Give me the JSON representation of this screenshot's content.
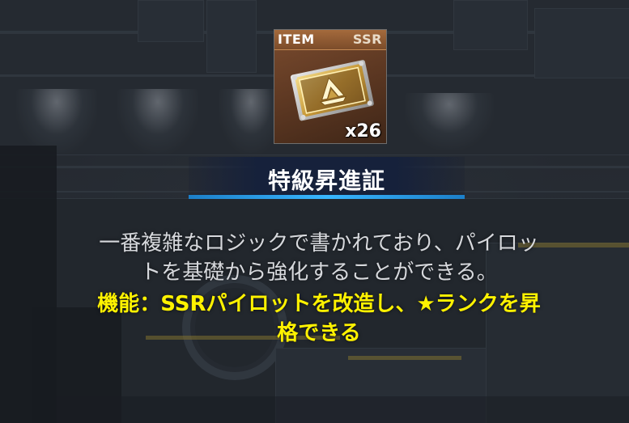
{
  "item": {
    "type_label": "ITEM",
    "rarity": "SSR",
    "count": "x26",
    "icon": "promotion-certificate-icon",
    "name": "特級昇進証"
  },
  "description": {
    "line1": "一番複雑なロジックで書かれており、パイロッ",
    "line2": "トを基礎から強化することができる。"
  },
  "function": {
    "line1": "機能：SSRパイロットを改造し、★ランクを昇",
    "line2": "格できる"
  },
  "colors": {
    "function_text": "#fff200",
    "banner_underline": "#38b6ff",
    "card_frame": "#7a4b2e"
  }
}
